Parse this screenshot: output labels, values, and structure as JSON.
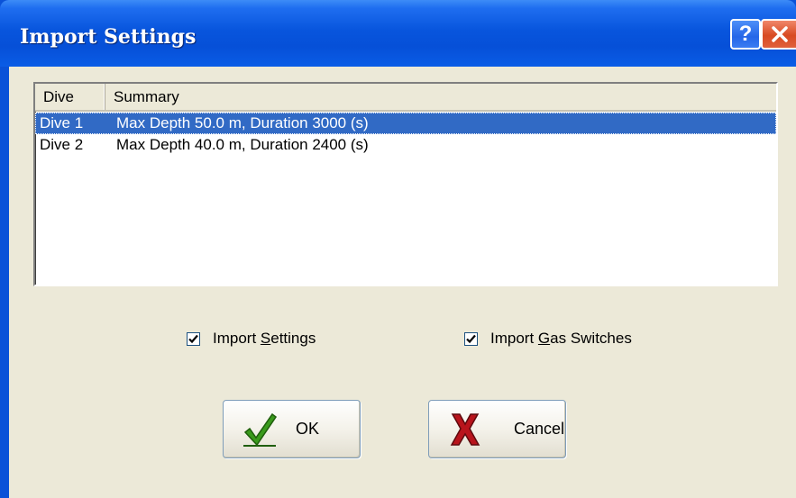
{
  "window": {
    "title": "Import Settings",
    "help_label": "?"
  },
  "list": {
    "columns": [
      "Dive",
      "Summary"
    ],
    "rows": [
      {
        "dive": "Dive 1",
        "summary": "Max Depth 50.0 m, Duration 3000 (s)",
        "selected": true
      },
      {
        "dive": "Dive 2",
        "summary": "Max Depth 40.0 m, Duration 2400 (s)",
        "selected": false
      }
    ]
  },
  "options": {
    "import_settings": {
      "label_pre": "Import ",
      "label_accel": "S",
      "label_post": "ettings",
      "checked": true
    },
    "import_gas_switches": {
      "label_pre": "Import ",
      "label_accel": "G",
      "label_post": "as Switches",
      "checked": true
    }
  },
  "buttons": {
    "ok_label": "OK",
    "cancel_label": "Cancel"
  },
  "colors": {
    "titlebar": "#0855dd",
    "selection": "#316ac5",
    "dialog_bg": "#ece9d8",
    "ok_check": "#3a9a1c",
    "cancel_x": "#b8141c"
  },
  "icons": {
    "help": "question-mark-icon",
    "close": "close-x-icon",
    "ok": "green-checkmark-icon",
    "cancel": "red-x-icon",
    "checkbox": "checkmark-icon"
  }
}
